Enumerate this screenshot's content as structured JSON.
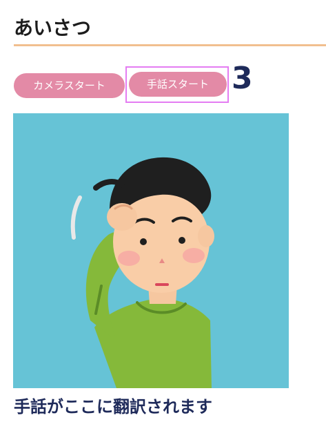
{
  "page": {
    "title": "あいさつ"
  },
  "controls": {
    "camera_start_label": "カメラスタート",
    "sign_start_label": "手話スタート",
    "countdown": "3"
  },
  "camera": {
    "illustration": "person-scratching-head-illustration"
  },
  "result": {
    "text": "手話がここに翻訳されます"
  },
  "colors": {
    "accent_rule": "#f1bf8f",
    "button": "#e38aa6",
    "focus_ring": "#e47cf2",
    "heading_navy": "#1e2a5a",
    "camera_bg": "#66c3d6"
  }
}
